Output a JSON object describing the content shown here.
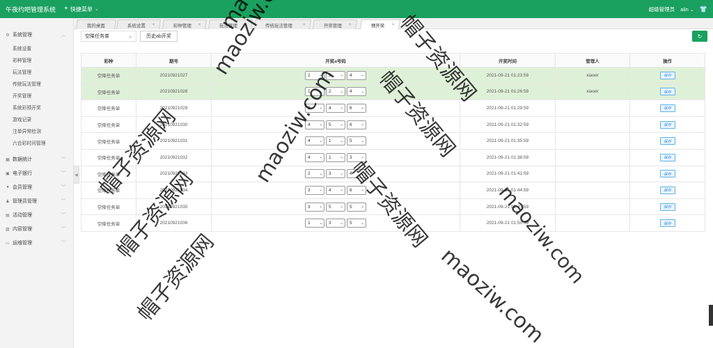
{
  "app": {
    "title": "午夜约吧管理系统",
    "quick_menu": "快捷菜单",
    "user_role": "超级管理员",
    "user_name": "alin"
  },
  "sidebar": {
    "groups": [
      {
        "label": "系统管理",
        "icon": "gear-icon",
        "items": [
          "系统设置",
          "彩种管理",
          "玩法管理",
          "传统玩法管理",
          "开奖管理",
          "系统彩预开奖",
          "游戏记录",
          "注单异常检测",
          "六合彩时间管理"
        ]
      },
      {
        "label": "数据统计",
        "icon": "chart-icon"
      },
      {
        "label": "电子银行",
        "icon": "bank-icon"
      },
      {
        "label": "会员管理",
        "icon": "user-icon"
      },
      {
        "label": "管理员管理",
        "icon": "admin-icon"
      },
      {
        "label": "活动管理",
        "icon": "calendar-icon"
      },
      {
        "label": "内容管理",
        "icon": "content-icon"
      },
      {
        "label": "运维管理",
        "icon": "monitor-icon"
      }
    ]
  },
  "tabs": [
    "我的桌面",
    "系统设置",
    "彩种管理",
    "玩法管理",
    "传统玩法管理",
    "开奖管理",
    "预开奖"
  ],
  "active_tab": 6,
  "toolbar": {
    "select_value": "空降任务单",
    "history_button": "历史ab开奖"
  },
  "table": {
    "headers": [
      "彩种",
      "期号",
      "开奖a号码",
      "开奖时间",
      "管理人",
      "操作"
    ],
    "save_label": "保存",
    "rows": [
      {
        "lottery": "空降任务单",
        "period": "20210921027",
        "numbers": [
          "2",
          "3",
          "4"
        ],
        "time": "2021-09-21 01:23:59",
        "manager": "xiaoer",
        "highlight": true
      },
      {
        "lottery": "空降任务单",
        "period": "20210921028",
        "numbers": [
          "1",
          "2",
          "4"
        ],
        "time": "2021-09-21 01:26:59",
        "manager": "xiaoer",
        "highlight": true
      },
      {
        "lottery": "空降任务单",
        "period": "20210921029",
        "numbers": [
          "2",
          "4",
          "6"
        ],
        "time": "2021-09-21 01:29:59",
        "manager": "",
        "highlight": false
      },
      {
        "lottery": "空降任务单",
        "period": "20210921030",
        "numbers": [
          "4",
          "5",
          "6"
        ],
        "time": "2021-09-21 01:32:59",
        "manager": "",
        "highlight": false
      },
      {
        "lottery": "空降任务单",
        "period": "20210921031",
        "numbers": [
          "4",
          "1",
          "5"
        ],
        "time": "2021-09-21 01:35:59",
        "manager": "",
        "highlight": false
      },
      {
        "lottery": "空降任务单",
        "period": "20210921032",
        "numbers": [
          "4",
          "1",
          "3"
        ],
        "time": "2021-09-21 01:38:59",
        "manager": "",
        "highlight": false
      },
      {
        "lottery": "空降任务单",
        "period": "20210921033",
        "numbers": [
          "2",
          "3",
          "4"
        ],
        "time": "2021-09-21 01:41:59",
        "manager": "",
        "highlight": false
      },
      {
        "lottery": "空降任务单",
        "period": "20210921034",
        "numbers": [
          "3",
          "4",
          "6"
        ],
        "time": "2021-09-21 01:44:59",
        "manager": "",
        "highlight": false
      },
      {
        "lottery": "空降任务单",
        "period": "20210921035",
        "numbers": [
          "3",
          "5",
          "5"
        ],
        "time": "2021-09-21 01:47:59",
        "manager": "",
        "highlight": false
      },
      {
        "lottery": "空降任务单",
        "period": "20210921036",
        "numbers": [
          "1",
          "3",
          "5"
        ],
        "time": "2021-09-21 01:50:59",
        "manager": "",
        "highlight": false
      }
    ]
  },
  "watermark": {
    "cn": "帽子资源网",
    "en": "maoziw.com"
  }
}
